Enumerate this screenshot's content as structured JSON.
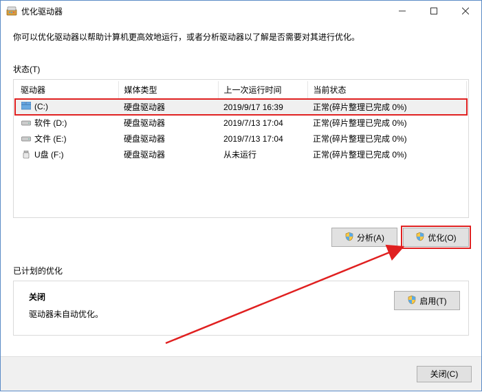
{
  "titlebar": {
    "title": "优化驱动器"
  },
  "intro": "你可以优化驱动器以帮助计算机更高效地运行，或者分析驱动器以了解是否需要对其进行优化。",
  "status_label": "状态(T)",
  "table": {
    "headers": {
      "drive": "驱动器",
      "media": "媒体类型",
      "lastrun": "上一次运行时间",
      "status": "当前状态"
    },
    "rows": [
      {
        "name": "(C:)",
        "media": "硬盘驱动器",
        "lastrun": "2019/9/17 16:39",
        "status": "正常(碎片整理已完成 0%)"
      },
      {
        "name": "软件 (D:)",
        "media": "硬盘驱动器",
        "lastrun": "2019/7/13 17:04",
        "status": "正常(碎片整理已完成 0%)"
      },
      {
        "name": "文件 (E:)",
        "media": "硬盘驱动器",
        "lastrun": "2019/7/13 17:04",
        "status": "正常(碎片整理已完成 0%)"
      },
      {
        "name": "U盘 (F:)",
        "media": "硬盘驱动器",
        "lastrun": "从未运行",
        "status": "正常(碎片整理已完成 0%)"
      }
    ]
  },
  "buttons": {
    "analyze": "分析(A)",
    "optimize": "优化(O)",
    "enable": "启用(T)",
    "close": "关闭(C)"
  },
  "scheduled": {
    "label": "已计划的优化",
    "status": "关闭",
    "sub": "驱动器未自动优化。"
  }
}
